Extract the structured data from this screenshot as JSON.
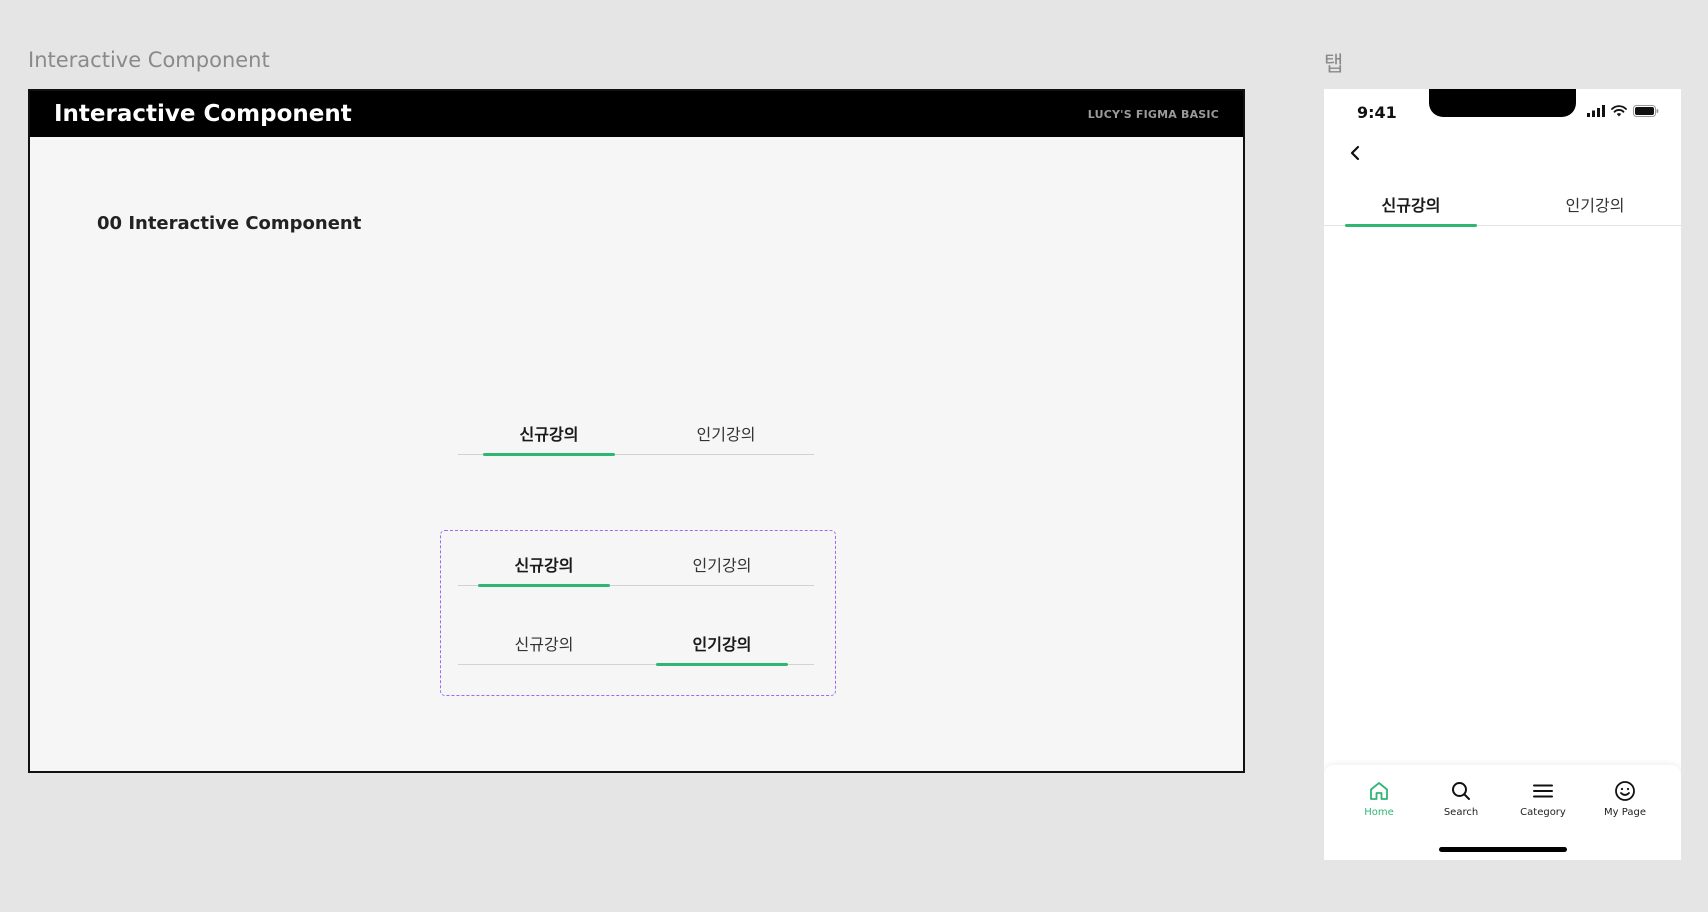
{
  "canvas": {
    "frame_label_main": "Interactive Component",
    "frame_label_tab": "탭"
  },
  "main_frame": {
    "header_title": "Interactive Component",
    "header_tag": "LUCY'S FIGMA BASIC",
    "section_title": "00 Interactive Component",
    "instance": {
      "tabs": [
        "신규강의",
        "인기강의"
      ],
      "active_index": 0
    },
    "variants": [
      {
        "tabs": [
          "신규강의",
          "인기강의"
        ],
        "active_index": 0
      },
      {
        "tabs": [
          "신규강의",
          "인기강의"
        ],
        "active_index": 1
      }
    ]
  },
  "phone": {
    "status_time": "9:41",
    "back_icon": "chevron-left-icon",
    "tabs": [
      "신규강의",
      "인기강의"
    ],
    "active_tab_index": 0,
    "bottom_nav": [
      {
        "label": "Home",
        "icon": "home-icon",
        "active": true
      },
      {
        "label": "Search",
        "icon": "search-icon",
        "active": false
      },
      {
        "label": "Category",
        "icon": "menu-icon",
        "active": false
      },
      {
        "label": "My Page",
        "icon": "smile-icon",
        "active": false
      }
    ]
  },
  "colors": {
    "accent_green": "#2fb673",
    "variant_border_purple": "#9b6cf0",
    "header_black": "#000000"
  }
}
